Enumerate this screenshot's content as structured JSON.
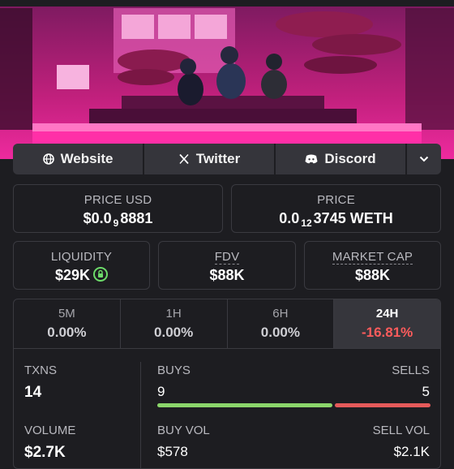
{
  "links": {
    "website": "Website",
    "twitter": "Twitter",
    "discord": "Discord"
  },
  "price_usd": {
    "label": "PRICE USD",
    "prefix": "$0.0",
    "sub": "9",
    "digits": "8881"
  },
  "price": {
    "label": "PRICE",
    "prefix": "0.0",
    "sub": "12",
    "digits": "3745 WETH"
  },
  "liquidity": {
    "label": "LIQUIDITY",
    "value": "$29K"
  },
  "fdv": {
    "label": "FDV",
    "value": "$88K"
  },
  "market_cap": {
    "label": "MARKET CAP",
    "value": "$88K"
  },
  "tabs": [
    {
      "label": "5M",
      "value": "0.00%"
    },
    {
      "label": "1H",
      "value": "0.00%"
    },
    {
      "label": "6H",
      "value": "0.00%"
    },
    {
      "label": "24H",
      "value": "-16.81%"
    }
  ],
  "txns": {
    "label": "TXNS",
    "value": "14"
  },
  "buys": {
    "label": "BUYS",
    "value": "9"
  },
  "sells": {
    "label": "SELLS",
    "value": "5"
  },
  "volume": {
    "label": "VOLUME",
    "value": "$2.7K"
  },
  "buy_vol": {
    "label": "BUY VOL",
    "value": "$578"
  },
  "sell_vol": {
    "label": "SELL VOL",
    "value": "$2.1K"
  },
  "colors": {
    "positive": "#8bd66b",
    "negative": "#e55a5a",
    "accent": "#e8209a"
  }
}
